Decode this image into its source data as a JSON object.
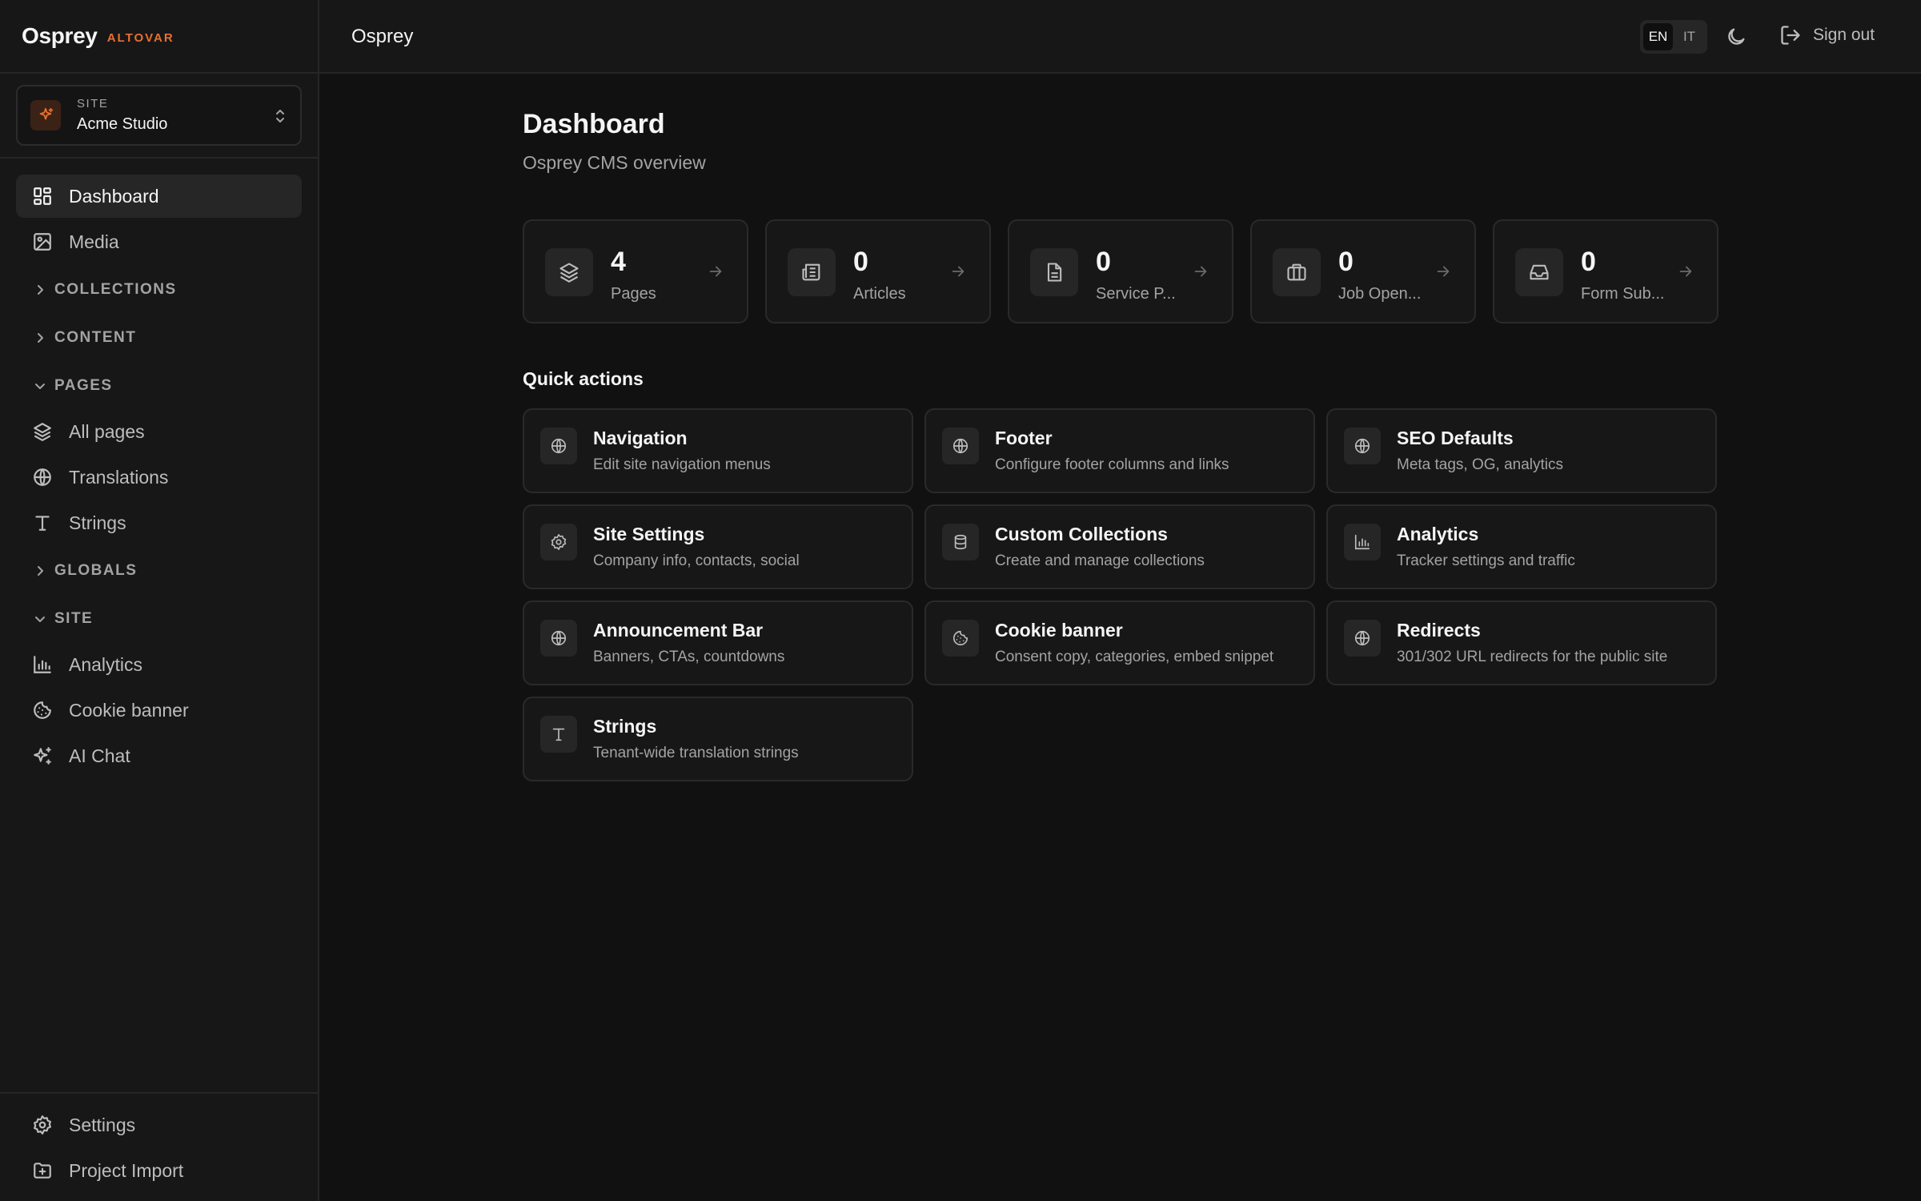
{
  "app": {
    "name": "Osprey",
    "tag": "ALTOVAR"
  },
  "site": {
    "label": "SITE",
    "name": "Acme Studio"
  },
  "sidebar": {
    "items": [
      {
        "label": "Dashboard"
      },
      {
        "label": "Media"
      }
    ],
    "groups": {
      "collections": "COLLECTIONS",
      "content": "CONTENT",
      "pages": "PAGES",
      "globals": "GLOBALS",
      "site": "SITE"
    },
    "pages_items": [
      {
        "label": "All pages"
      },
      {
        "label": "Translations"
      },
      {
        "label": "Strings"
      }
    ],
    "site_items": [
      {
        "label": "Analytics"
      },
      {
        "label": "Cookie banner"
      },
      {
        "label": "AI Chat"
      }
    ],
    "bottom": [
      {
        "label": "Settings"
      },
      {
        "label": "Project Import"
      }
    ]
  },
  "topbar": {
    "title": "Osprey",
    "lang_en": "EN",
    "lang_it": "IT",
    "signout": "Sign out"
  },
  "dashboard": {
    "title": "Dashboard",
    "subtitle": "Osprey CMS overview",
    "stats": [
      {
        "value": "4",
        "label": "Pages"
      },
      {
        "value": "0",
        "label": "Articles"
      },
      {
        "value": "0",
        "label": "Service P..."
      },
      {
        "value": "0",
        "label": "Job Open..."
      },
      {
        "value": "0",
        "label": "Form Sub..."
      }
    ],
    "quick_title": "Quick actions",
    "quick": [
      {
        "name": "Navigation",
        "desc": "Edit site navigation menus",
        "icon": "globe-icon"
      },
      {
        "name": "Footer",
        "desc": "Configure footer columns and links",
        "icon": "globe-icon"
      },
      {
        "name": "SEO Defaults",
        "desc": "Meta tags, OG, analytics",
        "icon": "globe-icon"
      },
      {
        "name": "Site Settings",
        "desc": "Company info, contacts, social",
        "icon": "gear-icon"
      },
      {
        "name": "Custom Collections",
        "desc": "Create and manage collections",
        "icon": "database-icon"
      },
      {
        "name": "Analytics",
        "desc": "Tracker settings and traffic",
        "icon": "bar-chart-icon"
      },
      {
        "name": "Announcement Bar",
        "desc": "Banners, CTAs, countdowns",
        "icon": "globe-icon"
      },
      {
        "name": "Cookie banner",
        "desc": "Consent copy, categories, embed snippet",
        "icon": "cookie-icon"
      },
      {
        "name": "Redirects",
        "desc": "301/302 URL redirects for the public site",
        "icon": "globe-icon"
      },
      {
        "name": "Strings",
        "desc": "Tenant-wide translation strings",
        "icon": "type-icon"
      }
    ]
  },
  "colors": {
    "accent": "#e8702f",
    "bg": "#111111",
    "panel": "#171717"
  }
}
